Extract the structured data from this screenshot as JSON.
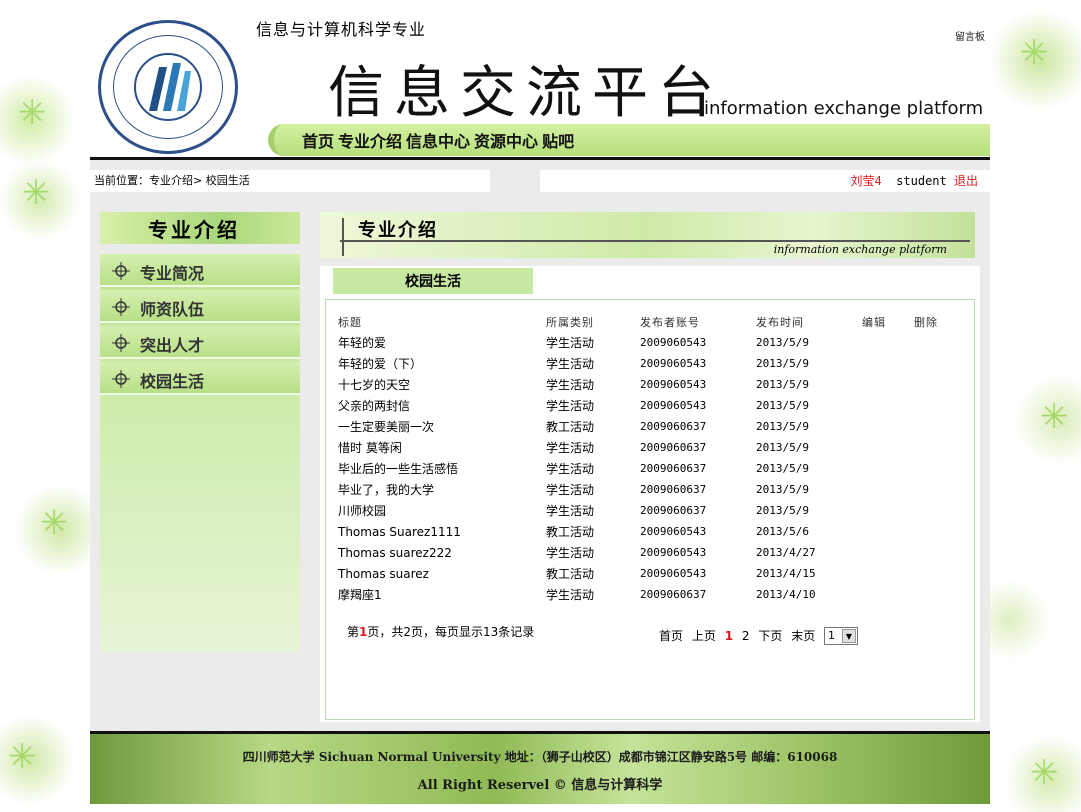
{
  "header": {
    "major": "信息与计算机科学专业",
    "title": "信息交流平台",
    "title_en": "information exchange platform",
    "guestbook": "留言板"
  },
  "nav": [
    "首页",
    "专业介绍",
    "信息中心",
    "资源中心",
    "贴吧"
  ],
  "breadcrumb": "当前位置：专业介绍> 校园生活",
  "user": {
    "name": "刘莹4",
    "role": "student",
    "logout": "退出"
  },
  "sidebar": {
    "title": "专业介绍",
    "items": [
      "专业简况",
      "师资队伍",
      "突出人才",
      "校园生活"
    ]
  },
  "content": {
    "title": "专业介绍",
    "title_en": "information exchange platform",
    "section": "校园生活"
  },
  "table": {
    "headers": [
      "标题",
      "所属类别",
      "发布者账号",
      "发布时间",
      "编辑",
      "删除"
    ],
    "rows": [
      [
        "年轻的爱",
        "学生活动",
        "2009060543",
        "2013/5/9"
      ],
      [
        "年轻的爱（下）",
        "学生活动",
        "2009060543",
        "2013/5/9"
      ],
      [
        "十七岁的天空",
        "学生活动",
        "2009060543",
        "2013/5/9"
      ],
      [
        "父亲的两封信",
        "学生活动",
        "2009060543",
        "2013/5/9"
      ],
      [
        "一生定要美丽一次",
        "教工活动",
        "2009060637",
        "2013/5/9"
      ],
      [
        "惜时 莫等闲",
        "学生活动",
        "2009060637",
        "2013/5/9"
      ],
      [
        "毕业后的一些生活感悟",
        "学生活动",
        "2009060637",
        "2013/5/9"
      ],
      [
        "毕业了，我的大学",
        "学生活动",
        "2009060637",
        "2013/5/9"
      ],
      [
        "川师校园",
        "学生活动",
        "2009060637",
        "2013/5/9"
      ],
      [
        "Thomas Suarez1111",
        "教工活动",
        "2009060543",
        "2013/5/6"
      ],
      [
        "Thomas suarez222",
        "学生活动",
        "2009060543",
        "2013/4/27"
      ],
      [
        "Thomas suarez",
        "教工活动",
        "2009060543",
        "2013/4/15"
      ],
      [
        "摩羯座1",
        "学生活动",
        "2009060637",
        "2013/4/10"
      ]
    ]
  },
  "pagination": {
    "info_prefix": "第",
    "current": "1",
    "info_suffix": "页，共2页，每页显示13条记录",
    "first": "首页",
    "prev": "上页",
    "pages": [
      "1",
      "2"
    ],
    "next": "下页",
    "last": "末页",
    "select_value": "1"
  },
  "footer": {
    "line1": "四川师范大学 Sichuan Normal University   地址：（狮子山校区）成都市锦江区静安路5号   邮编：610068",
    "line2": "All Right Reservel © 信息与计算科学"
  },
  "colors": {
    "accent_green": "#b6e07a",
    "red": "#d41c1c",
    "logo_blue": "#2c4f8a"
  },
  "icons": {
    "sidebar_bullet": "crosshair-icon",
    "select_arrow": "chevron-down-icon"
  }
}
